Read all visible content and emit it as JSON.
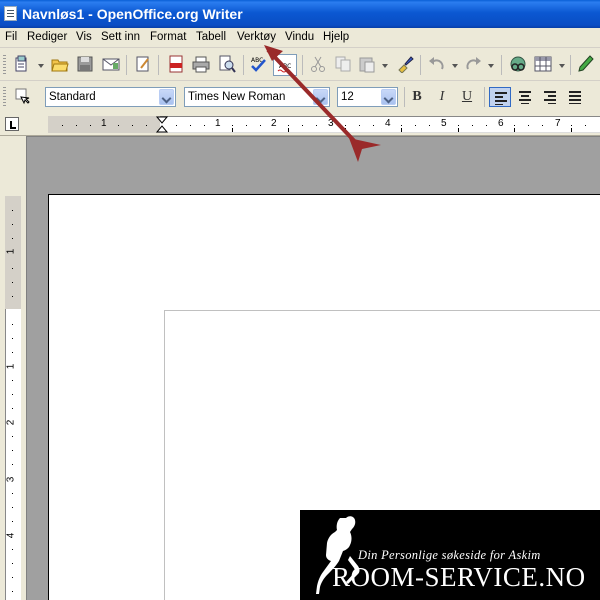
{
  "window": {
    "title": "Navnløs1 - OpenOffice.org Writer"
  },
  "menu": [
    "Fil",
    "Rediger",
    "Vis",
    "Sett inn",
    "Format",
    "Tabell",
    "Verktøy",
    "Vindu",
    "Hjelp"
  ],
  "formatting": {
    "paragraph_style": "Standard",
    "font_name": "Times New Roman",
    "font_size": "12",
    "bold_label": "B",
    "italic_label": "I",
    "underline_label": "U"
  },
  "ruler": {
    "h_numbers": [
      "1",
      "1",
      "2",
      "3",
      "4",
      "5",
      "6",
      "7"
    ],
    "v_numbers": [
      "1",
      "1",
      "2",
      "3",
      "4"
    ]
  },
  "watermark": {
    "tagline": "Din Personlige søkeside for Askim",
    "brand": "ROOM-SERVICE.NO"
  },
  "colors": {
    "titlebar": "#0a58d2",
    "arrow": "#9a2a2a",
    "chrome": "#ece9d8"
  }
}
